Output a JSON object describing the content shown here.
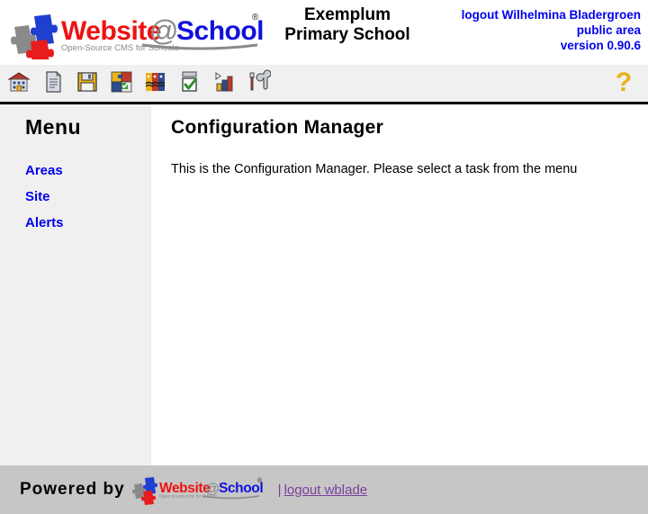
{
  "header": {
    "logo": {
      "word_website": "Website",
      "word_at": "@",
      "word_school": "School",
      "registered_mark": "®",
      "tagline": "Open-Source CMS for Schools"
    },
    "school_name_line1": "Exemplum",
    "school_name_line2": "Primary School",
    "session": {
      "logout_text": "logout Wilhelmina Bladergroen",
      "area": "public area",
      "version": "version 0.90.6"
    }
  },
  "toolbar": {
    "items": [
      {
        "name": "school-icon",
        "title": "School"
      },
      {
        "name": "page-icon",
        "title": "Pages"
      },
      {
        "name": "floppy-disk-icon",
        "title": "Save"
      },
      {
        "name": "modules-icon",
        "title": "Modules"
      },
      {
        "name": "users-icon",
        "title": "Users"
      },
      {
        "name": "checklist-icon",
        "title": "Tasks"
      },
      {
        "name": "statistics-icon",
        "title": "Statistics"
      },
      {
        "name": "tools-icon",
        "title": "Tools"
      }
    ],
    "help_label": "?"
  },
  "sidebar": {
    "heading": "Menu",
    "items": [
      {
        "label": "Areas"
      },
      {
        "label": "Site"
      },
      {
        "label": "Alerts"
      }
    ]
  },
  "main": {
    "title": "Configuration Manager",
    "body_text": "This is the Configuration Manager. Please select a task from the menu"
  },
  "footer": {
    "powered_by": "Powered by",
    "logo": {
      "word_website": "Website",
      "word_at": "@",
      "word_school": "School",
      "registered_mark": "®",
      "tagline": "Open source cms for schools"
    },
    "separator": "|",
    "logout_link": "logout wblade"
  },
  "colors": {
    "link_blue": "#0000ee",
    "logo_red": "#ee1111",
    "logo_blue": "#1111dd",
    "logo_gray": "#8a8a8a",
    "help_yellow": "#e8b21c",
    "footer_link_purple": "#7a3f9d",
    "sidebar_bg": "#f0f0f0",
    "footer_bg": "#c6c6c6"
  }
}
